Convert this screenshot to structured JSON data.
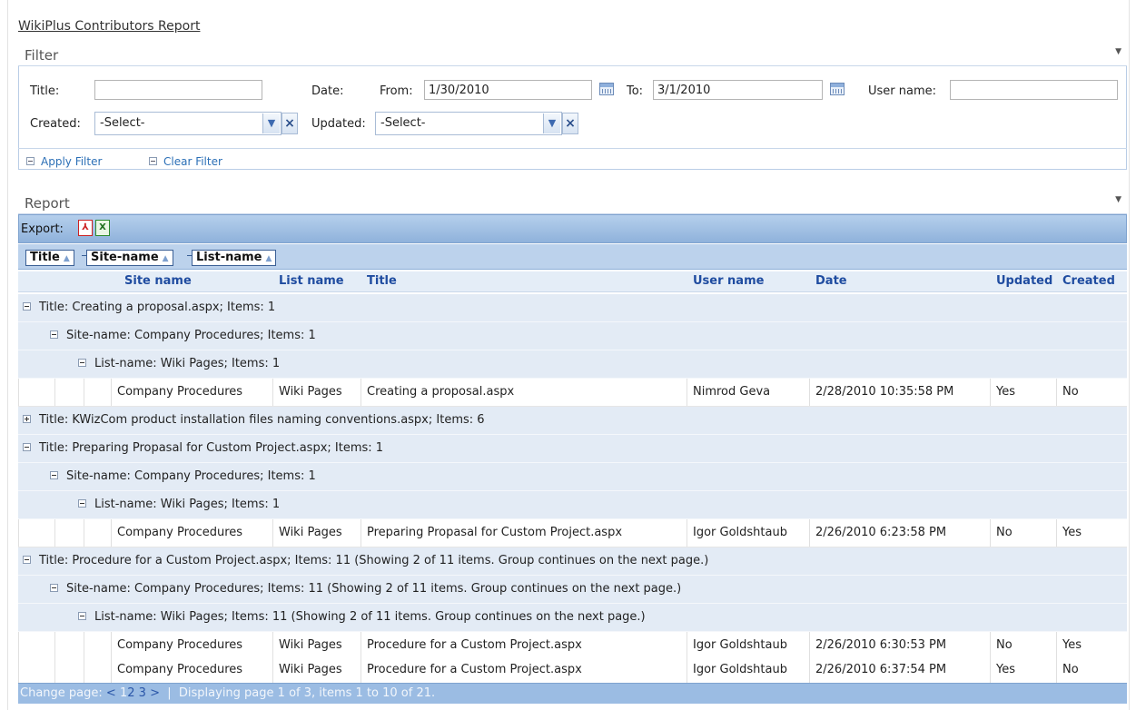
{
  "report_title": "WikiPlus Contributors Report",
  "filter": {
    "heading": "Filter",
    "title_label": "Title:",
    "title_value": "",
    "date_label": "Date:",
    "from_label": "From:",
    "from_value": "1/30/2010",
    "to_label": "To:",
    "to_value": "3/1/2010",
    "username_label": "User name:",
    "username_value": "",
    "created_label": "Created:",
    "created_value": "-Select-",
    "updated_label": "Updated:",
    "updated_value": "-Select-",
    "apply_label": "Apply Filter",
    "clear_label": "Clear Filter"
  },
  "report": {
    "heading": "Report",
    "export_label": "Export:",
    "export_pdf_icon": "pdf-icon",
    "export_excel_icon": "excel-icon",
    "group_tags": [
      "Title",
      "Site-name",
      "List-name"
    ],
    "columns": [
      "Site name",
      "List name",
      "Title",
      "User name",
      "Date",
      "Updated",
      "Created"
    ],
    "g1": "Title: Creating a proposal.aspx; Items: 1",
    "g1s": "Site-name: Company Procedures; Items: 1",
    "g1l": "List-name: Wiki Pages; Items: 1",
    "r1": [
      "Company Procedures",
      "Wiki Pages",
      "Creating a proposal.aspx",
      "Nimrod Geva",
      "2/28/2010 10:35:58 PM",
      "Yes",
      "No"
    ],
    "g2": "Title: KWizCom product installation files naming conventions.aspx; Items: 6",
    "g3": "Title: Preparing Propasal for Custom Project.aspx; Items: 1",
    "g3s": "Site-name: Company Procedures; Items: 1",
    "g3l": "List-name: Wiki Pages; Items: 1",
    "r2": [
      "Company Procedures",
      "Wiki Pages",
      "Preparing Propasal for Custom Project.aspx",
      "Igor Goldshtaub",
      "2/26/2010 6:23:58 PM",
      "No",
      "Yes"
    ],
    "g4": "Title: Procedure for a Custom Project.aspx; Items: 11 (Showing 2 of 11 items. Group continues on the next page.)",
    "g4s": "Site-name: Company Procedures; Items: 11 (Showing 2 of 11 items. Group continues on the next page.)",
    "g4l": "List-name: Wiki Pages; Items: 11 (Showing 2 of 11 items. Group continues on the next page.)",
    "r3": [
      "Company Procedures",
      "Wiki Pages",
      "Procedure for a Custom Project.aspx",
      "Igor Goldshtaub",
      "2/26/2010 6:30:53 PM",
      "No",
      "Yes"
    ],
    "r4": [
      "Company Procedures",
      "Wiki Pages",
      "Procedure for a Custom Project.aspx",
      "Igor Goldshtaub",
      "2/26/2010 6:37:54 PM",
      "Yes",
      "No"
    ]
  },
  "pager": {
    "label": "Change page:",
    "prev": "<",
    "pages": [
      "1",
      "2",
      "3"
    ],
    "next": ">",
    "sep": "|",
    "status": "Displaying page 1 of 3, items 1 to 10 of 21."
  }
}
